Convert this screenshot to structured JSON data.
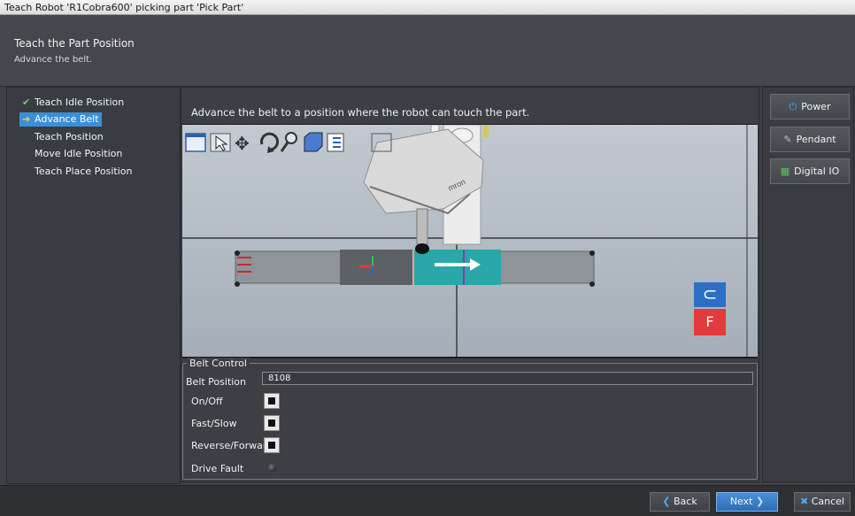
{
  "window": {
    "title": "Teach Robot 'R1Cobra600' picking part 'Pick Part'"
  },
  "header": {
    "heading": "Teach the Part Position",
    "subheading": "Advance the belt."
  },
  "steps": [
    {
      "label": "Teach Idle Position",
      "state": "done",
      "icon": "check-icon"
    },
    {
      "label": "Advance Belt",
      "state": "current",
      "icon": "arrow-right-icon"
    },
    {
      "label": "Teach Position",
      "state": "pending"
    },
    {
      "label": "Move Idle Position",
      "state": "pending"
    },
    {
      "label": "Teach Place Position",
      "state": "pending"
    }
  ],
  "main": {
    "instruction": "Advance the belt to a position where the robot can touch the part."
  },
  "viewport_toolbar": {
    "icons": [
      "view-frame-icon",
      "select-pointer-icon",
      "pan-icon",
      "rotate-icon",
      "zoom-icon",
      "solid-view-icon",
      "properties-icon",
      "frame-icon"
    ]
  },
  "viewport_overlay": {
    "cube_face_top": "⊂",
    "cube_face_front": "F",
    "colors": {
      "top": "#2d6fc6",
      "front": "#e23b3b"
    }
  },
  "side_buttons": [
    {
      "label": "Power",
      "icon": "power-icon"
    },
    {
      "label": "Pendant",
      "icon": "pendant-icon"
    },
    {
      "label": "Digital IO",
      "icon": "digital-io-icon"
    }
  ],
  "belt_control": {
    "legend": "Belt Control",
    "position_label": "Belt Position",
    "position_value": "8108",
    "on_off_label": "On/Off",
    "fast_slow_label": "Fast/Slow",
    "reverse_forward_label": "Reverse/Forward",
    "drive_fault_label": "Drive Fault"
  },
  "footer": {
    "back_label": "Back",
    "next_label": "Next",
    "cancel_label": "Cancel"
  }
}
